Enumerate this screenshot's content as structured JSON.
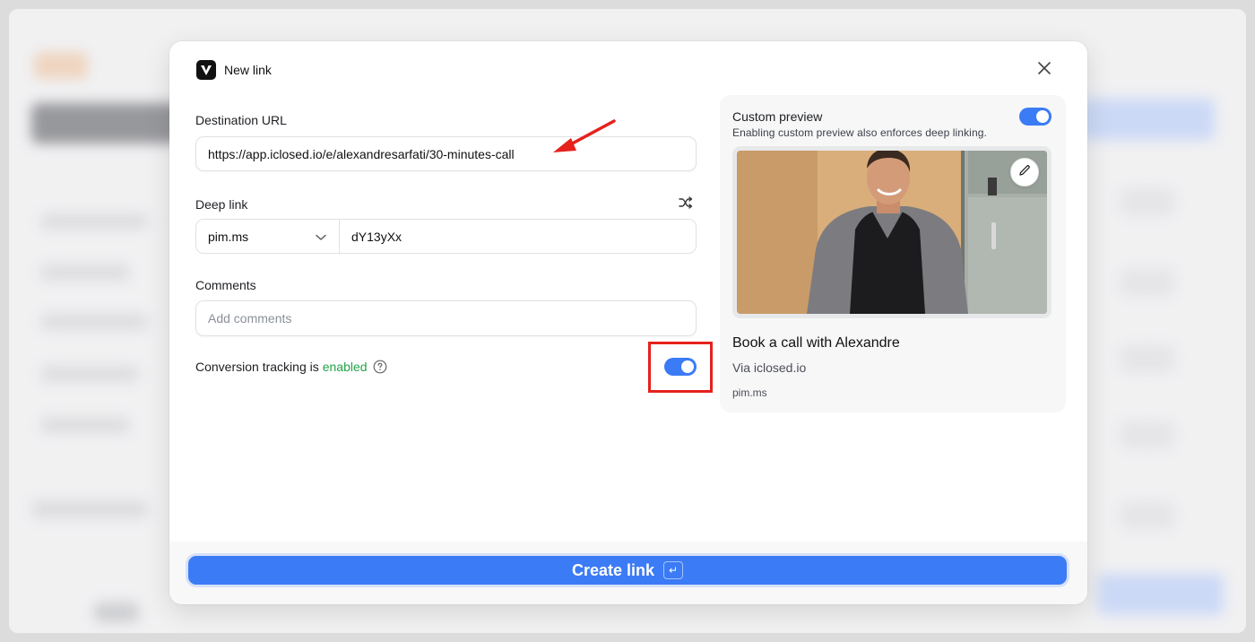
{
  "modal": {
    "title": "New link",
    "close_icon": "close-icon",
    "logo_icon": "app-logo-icon"
  },
  "form": {
    "destination_label": "Destination URL",
    "destination_value": "https://app.iclosed.io/e/alexandresarfati/30-minutes-call",
    "deep_link_label": "Deep link",
    "domain_value": "pim.ms",
    "slug_value": "dY13yXx",
    "comments_label": "Comments",
    "comments_placeholder": "Add comments",
    "tracking_text": "Conversion tracking is",
    "tracking_status": "enabled",
    "tracking_toggle_on": true
  },
  "preview": {
    "title": "Custom preview",
    "description": "Enabling custom preview also enforces deep linking.",
    "toggle_on": true,
    "card_title": "Book a call with Alexandre",
    "card_via": "Via iclosed.io",
    "card_domain": "pim.ms"
  },
  "footer": {
    "create_label": "Create link",
    "enter_key": "↵"
  },
  "colors": {
    "accent": "#3b7bf5",
    "enabled_green": "#22a447",
    "annotation_red": "#e5221c"
  }
}
